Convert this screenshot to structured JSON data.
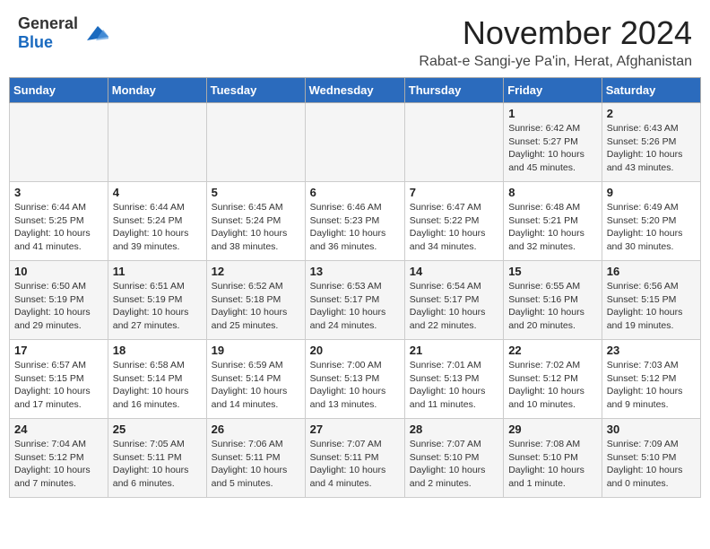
{
  "header": {
    "logo_general": "General",
    "logo_blue": "Blue",
    "month": "November 2024",
    "location": "Rabat-e Sangi-ye Pa'in, Herat, Afghanistan"
  },
  "weekdays": [
    "Sunday",
    "Monday",
    "Tuesday",
    "Wednesday",
    "Thursday",
    "Friday",
    "Saturday"
  ],
  "weeks": [
    [
      {
        "day": "",
        "info": ""
      },
      {
        "day": "",
        "info": ""
      },
      {
        "day": "",
        "info": ""
      },
      {
        "day": "",
        "info": ""
      },
      {
        "day": "",
        "info": ""
      },
      {
        "day": "1",
        "info": "Sunrise: 6:42 AM\nSunset: 5:27 PM\nDaylight: 10 hours\nand 45 minutes."
      },
      {
        "day": "2",
        "info": "Sunrise: 6:43 AM\nSunset: 5:26 PM\nDaylight: 10 hours\nand 43 minutes."
      }
    ],
    [
      {
        "day": "3",
        "info": "Sunrise: 6:44 AM\nSunset: 5:25 PM\nDaylight: 10 hours\nand 41 minutes."
      },
      {
        "day": "4",
        "info": "Sunrise: 6:44 AM\nSunset: 5:24 PM\nDaylight: 10 hours\nand 39 minutes."
      },
      {
        "day": "5",
        "info": "Sunrise: 6:45 AM\nSunset: 5:24 PM\nDaylight: 10 hours\nand 38 minutes."
      },
      {
        "day": "6",
        "info": "Sunrise: 6:46 AM\nSunset: 5:23 PM\nDaylight: 10 hours\nand 36 minutes."
      },
      {
        "day": "7",
        "info": "Sunrise: 6:47 AM\nSunset: 5:22 PM\nDaylight: 10 hours\nand 34 minutes."
      },
      {
        "day": "8",
        "info": "Sunrise: 6:48 AM\nSunset: 5:21 PM\nDaylight: 10 hours\nand 32 minutes."
      },
      {
        "day": "9",
        "info": "Sunrise: 6:49 AM\nSunset: 5:20 PM\nDaylight: 10 hours\nand 30 minutes."
      }
    ],
    [
      {
        "day": "10",
        "info": "Sunrise: 6:50 AM\nSunset: 5:19 PM\nDaylight: 10 hours\nand 29 minutes."
      },
      {
        "day": "11",
        "info": "Sunrise: 6:51 AM\nSunset: 5:19 PM\nDaylight: 10 hours\nand 27 minutes."
      },
      {
        "day": "12",
        "info": "Sunrise: 6:52 AM\nSunset: 5:18 PM\nDaylight: 10 hours\nand 25 minutes."
      },
      {
        "day": "13",
        "info": "Sunrise: 6:53 AM\nSunset: 5:17 PM\nDaylight: 10 hours\nand 24 minutes."
      },
      {
        "day": "14",
        "info": "Sunrise: 6:54 AM\nSunset: 5:17 PM\nDaylight: 10 hours\nand 22 minutes."
      },
      {
        "day": "15",
        "info": "Sunrise: 6:55 AM\nSunset: 5:16 PM\nDaylight: 10 hours\nand 20 minutes."
      },
      {
        "day": "16",
        "info": "Sunrise: 6:56 AM\nSunset: 5:15 PM\nDaylight: 10 hours\nand 19 minutes."
      }
    ],
    [
      {
        "day": "17",
        "info": "Sunrise: 6:57 AM\nSunset: 5:15 PM\nDaylight: 10 hours\nand 17 minutes."
      },
      {
        "day": "18",
        "info": "Sunrise: 6:58 AM\nSunset: 5:14 PM\nDaylight: 10 hours\nand 16 minutes."
      },
      {
        "day": "19",
        "info": "Sunrise: 6:59 AM\nSunset: 5:14 PM\nDaylight: 10 hours\nand 14 minutes."
      },
      {
        "day": "20",
        "info": "Sunrise: 7:00 AM\nSunset: 5:13 PM\nDaylight: 10 hours\nand 13 minutes."
      },
      {
        "day": "21",
        "info": "Sunrise: 7:01 AM\nSunset: 5:13 PM\nDaylight: 10 hours\nand 11 minutes."
      },
      {
        "day": "22",
        "info": "Sunrise: 7:02 AM\nSunset: 5:12 PM\nDaylight: 10 hours\nand 10 minutes."
      },
      {
        "day": "23",
        "info": "Sunrise: 7:03 AM\nSunset: 5:12 PM\nDaylight: 10 hours\nand 9 minutes."
      }
    ],
    [
      {
        "day": "24",
        "info": "Sunrise: 7:04 AM\nSunset: 5:12 PM\nDaylight: 10 hours\nand 7 minutes."
      },
      {
        "day": "25",
        "info": "Sunrise: 7:05 AM\nSunset: 5:11 PM\nDaylight: 10 hours\nand 6 minutes."
      },
      {
        "day": "26",
        "info": "Sunrise: 7:06 AM\nSunset: 5:11 PM\nDaylight: 10 hours\nand 5 minutes."
      },
      {
        "day": "27",
        "info": "Sunrise: 7:07 AM\nSunset: 5:11 PM\nDaylight: 10 hours\nand 4 minutes."
      },
      {
        "day": "28",
        "info": "Sunrise: 7:07 AM\nSunset: 5:10 PM\nDaylight: 10 hours\nand 2 minutes."
      },
      {
        "day": "29",
        "info": "Sunrise: 7:08 AM\nSunset: 5:10 PM\nDaylight: 10 hours\nand 1 minute."
      },
      {
        "day": "30",
        "info": "Sunrise: 7:09 AM\nSunset: 5:10 PM\nDaylight: 10 hours\nand 0 minutes."
      }
    ]
  ]
}
